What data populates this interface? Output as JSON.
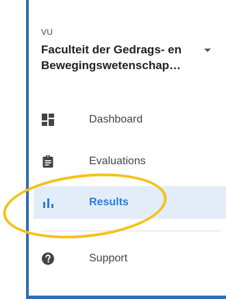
{
  "org": {
    "short": "VU",
    "name": "Faculteit der Gedrags- en\nBewegingswetenschap…"
  },
  "colors": {
    "accent": "#2f7bd8",
    "frame_border": "#2f6db2",
    "active_bg": "#e3edf9",
    "highlight": "#f5c11b"
  },
  "nav": {
    "items": [
      {
        "label": "Dashboard",
        "icon": "dashboard-icon",
        "active": false
      },
      {
        "label": "Evaluations",
        "icon": "clipboard-icon",
        "active": false
      },
      {
        "label": "Results",
        "icon": "bar-chart-icon",
        "active": true
      },
      {
        "label": "Support",
        "icon": "help-icon",
        "active": false
      }
    ]
  }
}
